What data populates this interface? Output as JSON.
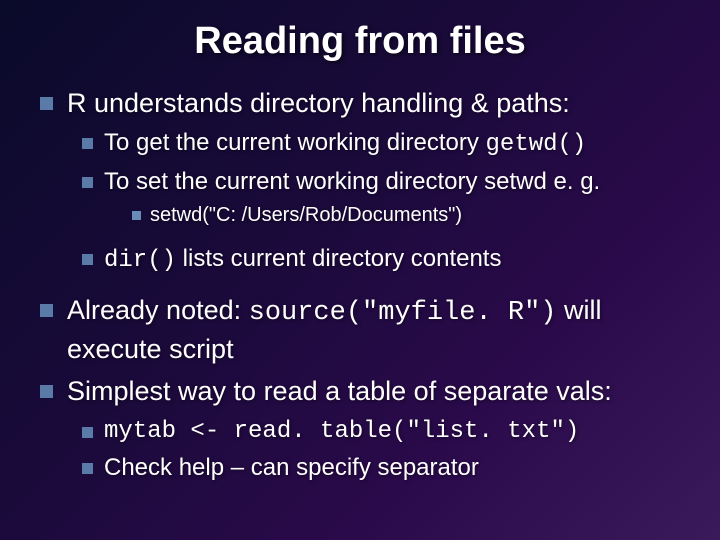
{
  "title": "Reading from files",
  "b1": {
    "text": "R understands directory handling & paths:",
    "sub": {
      "s1_pre": "To get the current working directory ",
      "s1_code": "getwd()",
      "s2": "To set the current working directory setwd e. g.",
      "s2_sub": "setwd(\"C: /Users/Rob/Documents\")",
      "s3_code": "dir()",
      "s3_post": " lists current directory contents"
    }
  },
  "b2": {
    "pre": "Already noted: ",
    "code": "source(\"myfile. R\")",
    "post": " will execute script"
  },
  "b3": {
    "text": "Simplest way to read a table of separate vals:",
    "sub": {
      "s1_code": "mytab <- read. table(\"list. txt\")",
      "s2": "Check help – can specify separator"
    }
  }
}
